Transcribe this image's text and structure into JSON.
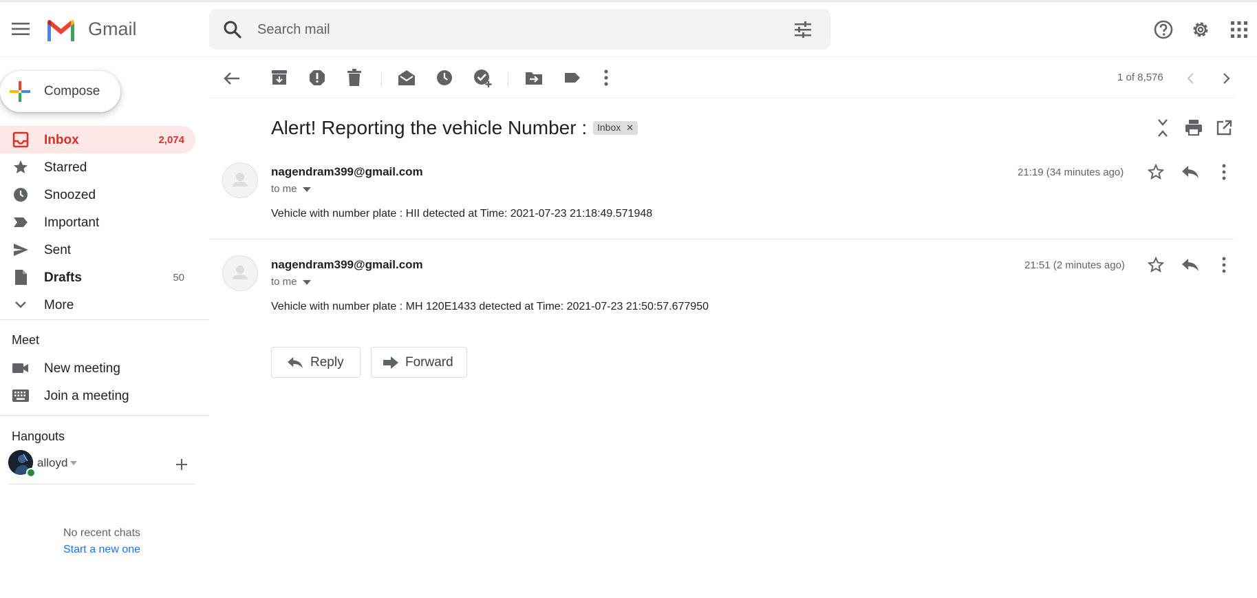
{
  "app": {
    "brand": "Gmail",
    "search_placeholder": "Search mail"
  },
  "compose_label": "Compose",
  "nav": [
    {
      "label": "Inbox",
      "count": "2,074",
      "active": true,
      "icon": "inbox-icon"
    },
    {
      "label": "Starred",
      "count": "",
      "icon": "star-icon"
    },
    {
      "label": "Snoozed",
      "count": "",
      "icon": "clock-icon"
    },
    {
      "label": "Important",
      "count": "",
      "icon": "important-icon"
    },
    {
      "label": "Sent",
      "count": "",
      "icon": "send-icon"
    },
    {
      "label": "Drafts",
      "count": "50",
      "bold": true,
      "icon": "draft-icon"
    },
    {
      "label": "More",
      "count": "",
      "icon": "chevron-down-icon"
    }
  ],
  "meet": {
    "title": "Meet",
    "new_meeting": "New meeting",
    "join_meeting": "Join a meeting"
  },
  "hangouts": {
    "title": "Hangouts",
    "user": "alloyd",
    "no_recent": "No recent chats",
    "start_new": "Start a new one"
  },
  "toolbar": {
    "pager": "1 of 8,576"
  },
  "thread": {
    "subject": "Alert! Reporting the vehicle Number :",
    "label": "Inbox",
    "messages": [
      {
        "sender": "nagendram399@gmail.com",
        "to": "to me",
        "time": "21:19 (34 minutes ago)",
        "body": "Vehicle with number plate : HII detected at Time: 2021-07-23 21:18:49.571948"
      },
      {
        "sender": "nagendram399@gmail.com",
        "to": "to me",
        "time": "21:51 (2 minutes ago)",
        "body": "Vehicle with number plate : MH 120E1433 detected at Time: 2021-07-23 21:50:57.677950"
      }
    ]
  },
  "actions": {
    "reply": "Reply",
    "forward": "Forward"
  },
  "colors": {
    "accent_red": "#d93025",
    "active_bg": "#fce8e6",
    "link_blue": "#1a73e8",
    "online_green": "#1e8e3e"
  }
}
